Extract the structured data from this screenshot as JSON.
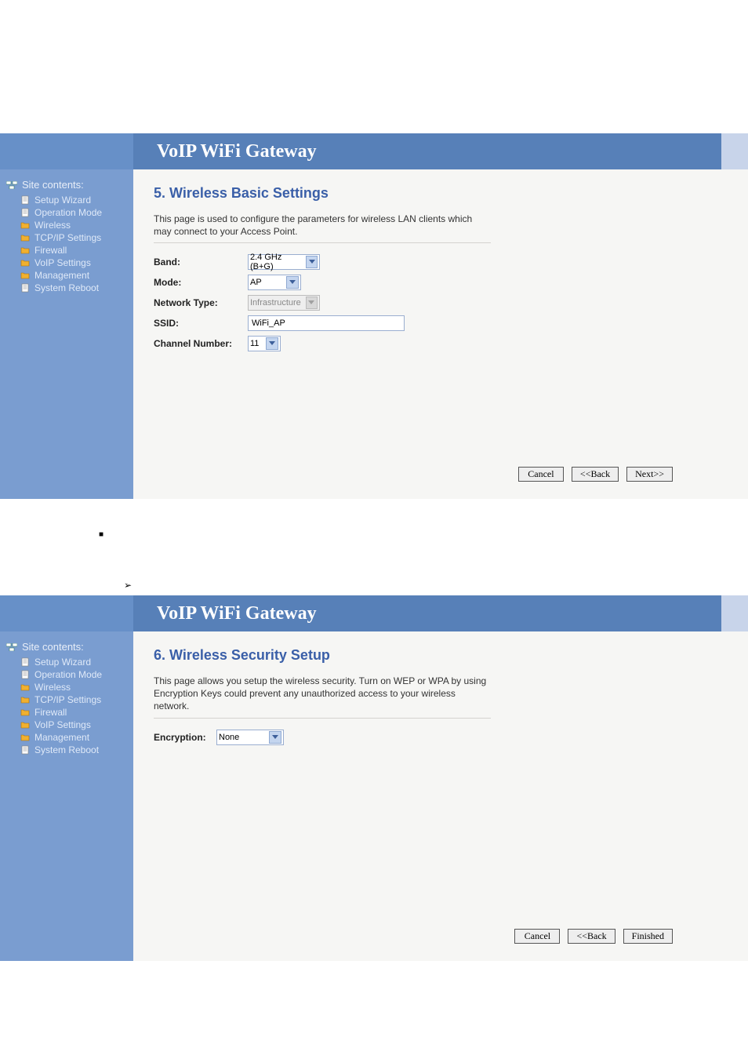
{
  "header_title": "VoIP WiFi Gateway",
  "sidebar": {
    "title": "Site contents:",
    "items": [
      {
        "label": "Setup Wizard",
        "icon": "page"
      },
      {
        "label": "Operation Mode",
        "icon": "page"
      },
      {
        "label": "Wireless",
        "icon": "folder"
      },
      {
        "label": "TCP/IP Settings",
        "icon": "folder"
      },
      {
        "label": "Firewall",
        "icon": "folder"
      },
      {
        "label": "VoIP Settings",
        "icon": "folder"
      },
      {
        "label": "Management",
        "icon": "folder"
      },
      {
        "label": "System Reboot",
        "icon": "page"
      }
    ]
  },
  "screen5": {
    "title": "5. Wireless Basic Settings",
    "desc": "This page is used to configure the parameters for wireless LAN clients which may connect to your Access Point.",
    "labels": {
      "band": "Band:",
      "mode": "Mode:",
      "network_type": "Network Type:",
      "ssid": "SSID:",
      "channel": "Channel Number:"
    },
    "values": {
      "band": "2.4 GHz (B+G)",
      "mode": "AP",
      "network_type": "Infrastructure",
      "ssid": "WiFi_AP",
      "channel": "11"
    },
    "buttons": {
      "cancel": "Cancel",
      "back": "<<Back",
      "next": "Next>>"
    }
  },
  "screen6": {
    "title": "6. Wireless Security Setup",
    "desc": "This page allows you setup the wireless security. Turn on WEP or WPA by using Encryption Keys could prevent any unauthorized access to your wireless network.",
    "labels": {
      "encryption": "Encryption:"
    },
    "values": {
      "encryption": "None"
    },
    "buttons": {
      "cancel": "Cancel",
      "back": "<<Back",
      "finished": "Finished"
    }
  }
}
